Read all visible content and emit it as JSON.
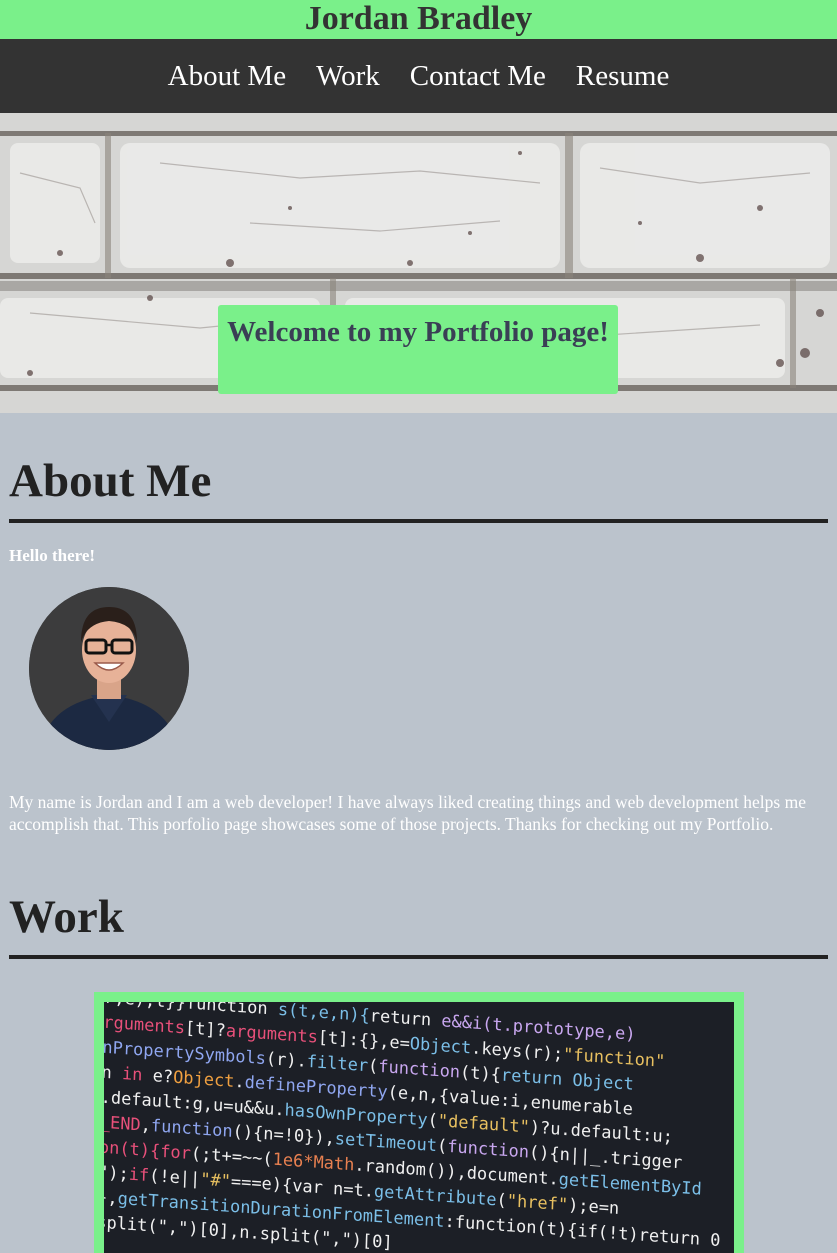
{
  "site": {
    "title": "Jordan Bradley"
  },
  "nav": {
    "items": [
      "About Me",
      "Work",
      "Contact Me",
      "Resume"
    ]
  },
  "hero": {
    "welcome_text": "Welcome to my Portfolio page!"
  },
  "about": {
    "heading": "About Me",
    "greeting": "Hello there!",
    "bio": "My name is Jordan and I am a web developer! I have always liked creating things and web development helps me accomplish that. This porfolio page showcases some of those projects. Thanks for checking out my Portfolio."
  },
  "work": {
    "heading": "Work"
  },
  "colors": {
    "accent": "#7af08a",
    "nav_bg": "#333333",
    "page_bg": "#bbc3cc"
  }
}
